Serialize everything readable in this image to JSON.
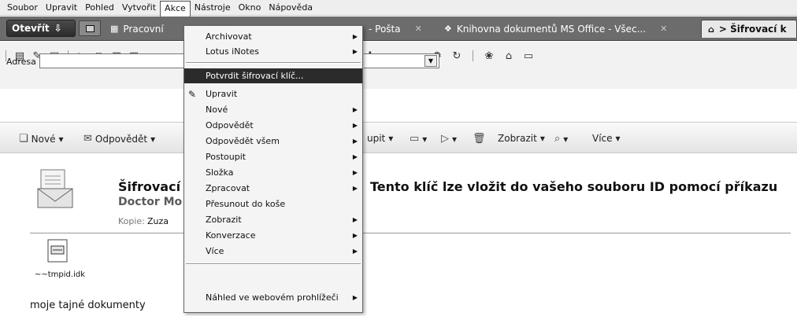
{
  "menubar": {
    "items": [
      "Soubor",
      "Upravit",
      "Pohled",
      "Vytvořit",
      "Akce",
      "Nástroje",
      "Okno",
      "Nápověda"
    ]
  },
  "tabs": {
    "open_label": "Otevřít",
    "items": [
      {
        "label": "Pracovní"
      },
      {
        "label": "- Pošta"
      },
      {
        "label": "Knihovna dokumentů MS Office - Všec..."
      },
      {
        "label": "> Šifrovací k"
      }
    ]
  },
  "address": {
    "label": "Adresa",
    "value": ""
  },
  "actionbar": {
    "new": "Nové",
    "reply": "Odpovědět",
    "forward": "upit",
    "view": "Zobrazit",
    "more": "Více"
  },
  "document": {
    "subject": "Šifrovací",
    "subject_tail": "Tento klíč lze vložit do vašeho souboru ID pomocí příkazu",
    "sender": "Doctor Mo",
    "cc_label": "Kopie:",
    "cc_value": "Zuza",
    "attachment": "~~tmpid.idk",
    "body": "moje tajné dokumenty"
  },
  "menu": {
    "items": [
      {
        "label": "Archivovat",
        "submenu": true
      },
      {
        "label": "Lotus iNotes",
        "submenu": true
      },
      {
        "label": "Potvrdit šifrovací klíč...",
        "submenu": false,
        "highlighted": true
      },
      {
        "label": "Upravit",
        "submenu": false
      },
      {
        "label": "Nové",
        "submenu": true
      },
      {
        "label": "Odpovědět",
        "submenu": true
      },
      {
        "label": "Odpovědět všem",
        "submenu": true
      },
      {
        "label": "Postoupit",
        "submenu": true
      },
      {
        "label": "Složka",
        "submenu": true
      },
      {
        "label": "Zpracovat",
        "submenu": true
      },
      {
        "label": "Přesunout do koše",
        "submenu": false
      },
      {
        "label": "Zobrazit",
        "submenu": true
      },
      {
        "label": "Konverzace",
        "submenu": true
      },
      {
        "label": "Více",
        "submenu": true
      },
      {
        "label": "Náhled ve webovém prohlížeči",
        "submenu": true
      }
    ]
  }
}
